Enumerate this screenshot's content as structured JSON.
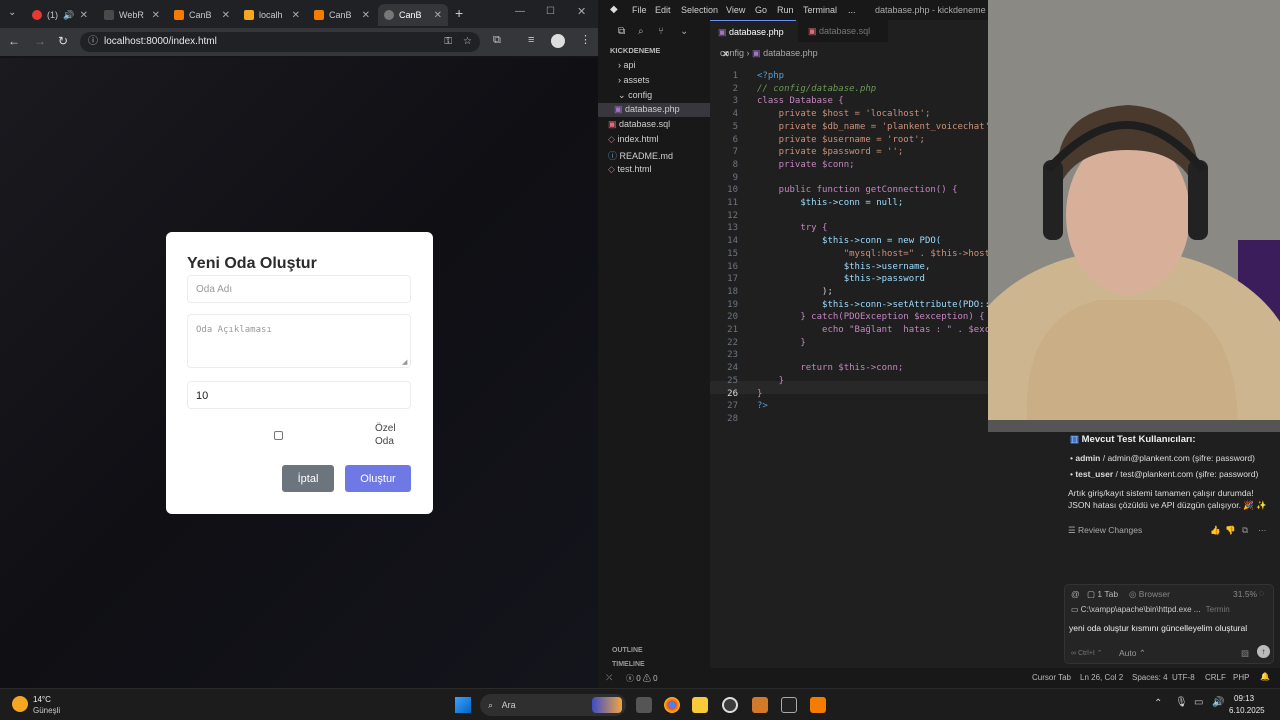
{
  "browser": {
    "tabs": [
      {
        "label": "(1)",
        "active": false
      },
      {
        "label": "WebR",
        "active": false
      },
      {
        "label": "CanB",
        "active": false
      },
      {
        "label": "localh",
        "active": false
      },
      {
        "label": "CanB",
        "active": false
      },
      {
        "label": "CanB",
        "active": true
      }
    ],
    "url": "localhost:8000/index.html"
  },
  "modal": {
    "title": "Yeni Oda Oluştur",
    "room_name_placeholder": "Oda Adı",
    "room_desc_placeholder": "Oda Açıklaması",
    "capacity_value": "10",
    "private_label": "Özel Oda",
    "cancel_label": "İptal",
    "create_label": "Oluştur"
  },
  "vscode": {
    "menu": [
      "File",
      "Edit",
      "Selection",
      "View",
      "Go",
      "Run",
      "Terminal",
      "..."
    ],
    "window_title": "database.php - kickdeneme - Cu",
    "open_tabs": [
      {
        "label": "database.php",
        "active": true
      },
      {
        "label": "database.sql",
        "active": false
      }
    ],
    "breadcrumb": [
      "config",
      "database.php"
    ],
    "explorer": {
      "root": "KICKDENEME",
      "items": [
        {
          "label": "api",
          "type": "folder",
          "depth": 0
        },
        {
          "label": "assets",
          "type": "folder",
          "depth": 0
        },
        {
          "label": "config",
          "type": "folder-open",
          "depth": 0
        },
        {
          "label": "database.php",
          "type": "file",
          "depth": 1,
          "selected": true
        },
        {
          "label": "database.sql",
          "type": "file",
          "depth": 0
        },
        {
          "label": "index.html",
          "type": "file",
          "depth": 0
        },
        {
          "label": "README.md",
          "type": "file",
          "depth": 0
        },
        {
          "label": "test.html",
          "type": "file",
          "depth": 0
        }
      ],
      "outline": "OUTLINE",
      "timeline": "TIMELINE"
    },
    "code": [
      {
        "n": "1",
        "t": "<?php"
      },
      {
        "n": "2",
        "t": "// config/database.php"
      },
      {
        "n": "3",
        "t": "class Database {"
      },
      {
        "n": "4",
        "t": "    private $host = 'localhost';"
      },
      {
        "n": "5",
        "t": "    private $db_name = 'plankent_voicechat';"
      },
      {
        "n": "6",
        "t": "    private $username = 'root';"
      },
      {
        "n": "7",
        "t": "    private $password = '';"
      },
      {
        "n": "8",
        "t": "    private $conn;"
      },
      {
        "n": "9",
        "t": ""
      },
      {
        "n": "10",
        "t": "    public function getConnection() {"
      },
      {
        "n": "11",
        "t": "        $this->conn = null;"
      },
      {
        "n": "12",
        "t": ""
      },
      {
        "n": "13",
        "t": "        try {"
      },
      {
        "n": "14",
        "t": "            $this->conn = new PDO("
      },
      {
        "n": "15",
        "t": "                \"mysql:host=\" . $this->host ."
      },
      {
        "n": "16",
        "t": "                $this->username,"
      },
      {
        "n": "17",
        "t": "                $this->password"
      },
      {
        "n": "18",
        "t": "            );"
      },
      {
        "n": "19",
        "t": "            $this->conn->setAttribute(PDO::AT"
      },
      {
        "n": "20",
        "t": "        } catch(PDOException $exception) {"
      },
      {
        "n": "21",
        "t": "            echo \"Bağlant  hatas : \" . $excep"
      },
      {
        "n": "22",
        "t": "        }"
      },
      {
        "n": "23",
        "t": ""
      },
      {
        "n": "24",
        "t": "        return $this->conn;"
      },
      {
        "n": "25",
        "t": "    }"
      },
      {
        "n": "26",
        "t": "}"
      },
      {
        "n": "27",
        "t": "?>"
      },
      {
        "n": "28",
        "t": ""
      }
    ],
    "status": {
      "errors": "0",
      "warnings": "0",
      "cursor_tab": "Cursor Tab",
      "position": "Ln 26, Col 2",
      "spaces": "Spaces: 4",
      "encoding": "UTF-8",
      "eol": "CRLF",
      "language": "PHP"
    }
  },
  "chat": {
    "heading": "Mevcut Test Kullanıcıları:",
    "users": [
      {
        "name": "admin",
        "detail": " / admin@plankent.com (şifre: password)"
      },
      {
        "name": "test_user",
        "detail": " / test@plankent.com (şifre: password)"
      }
    ],
    "message": "Artık giriş/kayıt sistemi tamamen çalışır durumda! JSON hatası çözüldü ve API düzgün çalışıyor. 🎉 ✨",
    "review_changes": "Review Changes",
    "context_tab": "1 Tab",
    "context_browser": "Browser",
    "context_pct": "31.5%",
    "terminal_ref": "C:\\xampp\\apache\\bin\\httpd.exe ...",
    "terminal_tag": "Termin",
    "input_text": "yeni oda oluştur kısmını güncelleyelim oluştural",
    "shortcut": "Ctrl+I",
    "mode": "Auto"
  },
  "taskbar": {
    "weather_temp": "14°C",
    "weather_desc": "Güneşli",
    "search_placeholder": "Ara",
    "time": "09:13",
    "date": "6.10.2025"
  },
  "colors": {
    "modal_cancel": "#6c757d",
    "modal_create": "#6f79e6",
    "vscode_bg": "#1f1f1f",
    "keyword": "#569cd6",
    "string": "#ce9178",
    "variable": "#9cdcfe"
  }
}
